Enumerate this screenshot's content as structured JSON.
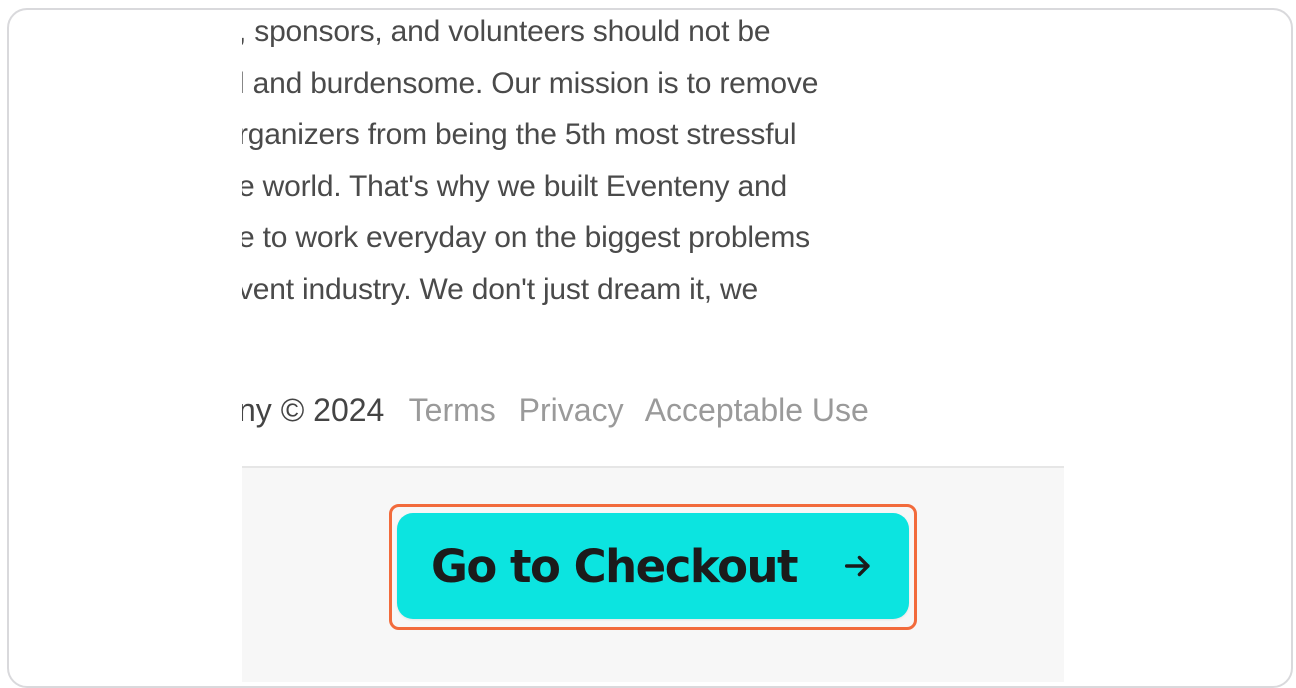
{
  "about": {
    "lines": [
      ", sponsors, and volunteers should not be",
      "l and burdensome. Our mission is to remove",
      "rganizers from being the 5th most stressful",
      "e world. That's why we built Eventeny and",
      "e to work everyday on the biggest problems",
      "vent industry. We don't just dream it, we"
    ]
  },
  "footer": {
    "copyright": "ny © 2024",
    "links": [
      "Terms",
      "Privacy",
      "Acceptable Use"
    ]
  },
  "checkout": {
    "button_label": "Go to Checkout",
    "icon": "arrow-right-icon"
  },
  "colors": {
    "button": "#0ce4e0",
    "highlight": "#f26b3c"
  }
}
